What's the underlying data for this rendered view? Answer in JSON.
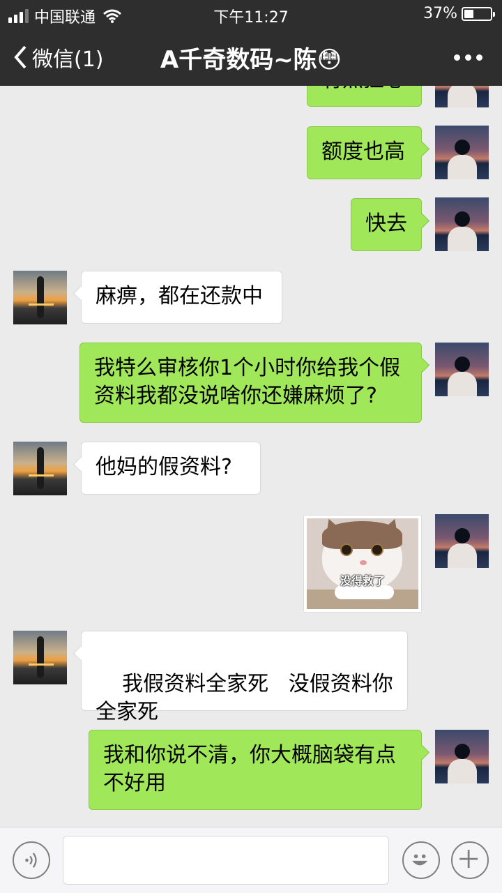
{
  "status_bar": {
    "carrier": "中国联通",
    "time": "下午11:27",
    "battery_percent": "37%",
    "battery_level": 0.37,
    "signal_bars": 3
  },
  "nav": {
    "back_label": "微信(1)",
    "title": "A千奇数码~陈😳",
    "more_icon": "more-dots-icon"
  },
  "messages": [
    {
      "sender": "self",
      "type": "text",
      "text": "有点担心",
      "partial": true
    },
    {
      "sender": "self",
      "type": "text",
      "text": "额度也高"
    },
    {
      "sender": "self",
      "type": "text",
      "text": "快去"
    },
    {
      "sender": "other",
      "type": "text",
      "text": "麻痹，都在还款中"
    },
    {
      "sender": "self",
      "type": "text",
      "text": "我特么审核你1个小时你给我个假资料我都没说啥你还嫌麻烦了?"
    },
    {
      "sender": "other",
      "type": "text",
      "text": "他妈的假资料?"
    },
    {
      "sender": "self",
      "type": "sticker",
      "caption": "没得救了"
    },
    {
      "sender": "other",
      "type": "text",
      "text": "我假资料全家死   没假资料你全家死"
    },
    {
      "sender": "self",
      "type": "text",
      "text": "我和你说不清，你大概脑袋有点不好用"
    }
  ],
  "input_bar": {
    "voice_icon": "voice-icon",
    "emoji_icon": "emoji-icon",
    "plus_icon": "plus-icon",
    "placeholder": ""
  },
  "colors": {
    "header_bg": "#2e2e2e",
    "chat_bg": "#ebebeb",
    "self_bubble": "#a0e75a",
    "other_bubble": "#ffffff"
  }
}
